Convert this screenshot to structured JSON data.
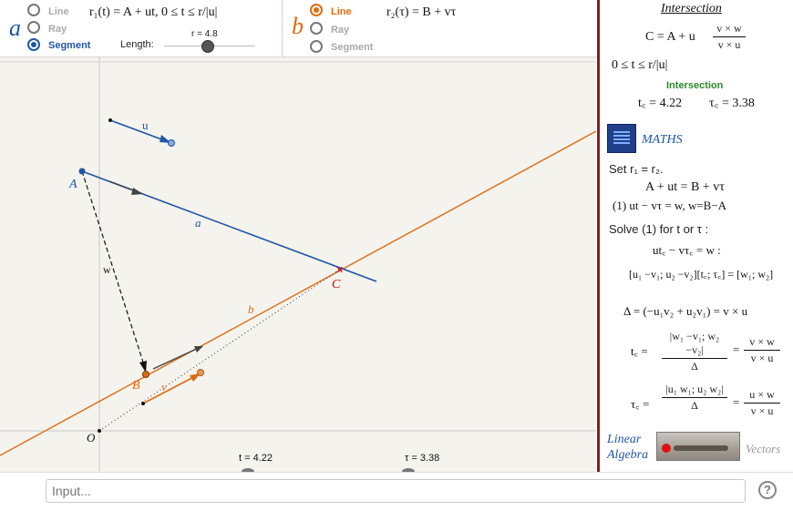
{
  "panel_a": {
    "letter": "a",
    "options": [
      "Line",
      "Ray",
      "Segment"
    ],
    "selected": "Segment",
    "formula": "r₁(t) = A + ut,    0 ≤ t ≤ r/|u|",
    "length_label": "Length:",
    "slider_label": "r = 4.8"
  },
  "panel_b": {
    "letter": "b",
    "options": [
      "Line",
      "Ray",
      "Segment"
    ],
    "selected": "Line",
    "formula": "r₂(τ) = B + vτ"
  },
  "canvas": {
    "points": {
      "A": "A",
      "B": "B",
      "C": "C",
      "O": "O"
    },
    "vectors": {
      "u": "u",
      "v": "v",
      "w": "w",
      "a": "a",
      "b": "b"
    },
    "slider_t_label": "t = 4.22",
    "slider_tau_label": "τ = 3.38"
  },
  "right_panel": {
    "title": "Intersection",
    "c_formula_left": "C = A + u",
    "c_frac_num": "v × w",
    "c_frac_den": "v × u",
    "constraint": "0 ≤ t ≤ r/|u|",
    "intersection_label": "Intersection",
    "tc_value": "t꜀ = 4.22",
    "tauc_value": "τ꜀ = 3.38",
    "maths_label": "MATHS",
    "set_text": "Set  r₁ = r₂.",
    "eq1": "A + ut = B + vτ",
    "eq2": "(1)  ut − vτ = w,     w=B−A",
    "solve_text": "Solve (1) for t or τ :",
    "eq3": "ut꜀ − vτ꜀ = w :",
    "matrix_eq": "[u₁ −v₁; u₂ −v₂][t꜀; τ꜀] = [w₁; w₂]",
    "delta_eq": "Δ = (−u₁v₂ + u₂v₁) = v × u",
    "tc_label": "t꜀ =",
    "tc_det": "|w₁ −v₁; w₂ −v₂|",
    "tc_den": "Δ",
    "tc_frac_num": "v × w",
    "tc_frac_den": "v × u",
    "tauc_label": "τ꜀ =",
    "tauc_det": "|u₁ w₁; u₂ w₂|",
    "tauc_den": "Δ",
    "tauc_frac_num": "u × w",
    "tauc_frac_den": "v × u",
    "linear_algebra": "Linear Algebra",
    "vectors_label": "Vectors"
  },
  "input_bar": {
    "placeholder": "Input...",
    "help": "?"
  },
  "colors": {
    "blue": "#1f56a6",
    "orange": "#e06a10",
    "dark_red": "#8b1a1a",
    "green": "#2a8a2a"
  }
}
